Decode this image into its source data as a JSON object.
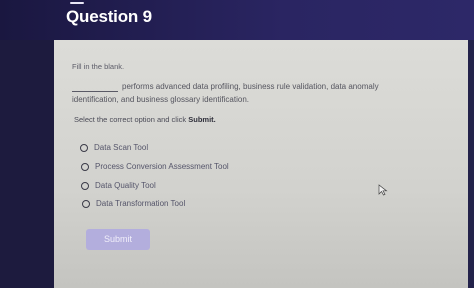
{
  "header": {
    "title": "Question 9"
  },
  "question": {
    "instruction": "Fill in the blank.",
    "text_line1": "performs advanced data profiling, business rule validation, data anomaly",
    "text_line2": "identification, and business glossary identification.",
    "select_prefix": "Select the correct option and click",
    "select_action": "Submit."
  },
  "options": [
    {
      "label": "Data Scan Tool",
      "selected": false
    },
    {
      "label": "Process Conversion Assessment Tool",
      "selected": false
    },
    {
      "label": "Data Quality Tool",
      "selected": false
    },
    {
      "label": "Data Transformation Tool",
      "selected": false
    }
  ],
  "submit": {
    "label": "Submit",
    "enabled": false
  },
  "colors": {
    "header_bg": "#2a2562",
    "card_bg": "#d6d6d2",
    "submit_bg": "#b3aedd"
  },
  "icons": {
    "header_bar": "header-bar-icon",
    "cursor": "mouse-cursor-icon"
  }
}
